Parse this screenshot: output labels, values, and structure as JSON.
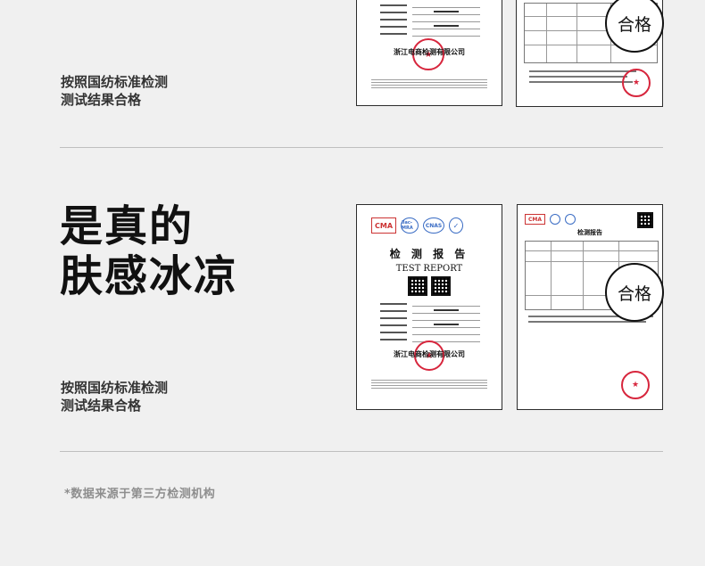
{
  "sections": [
    {
      "subtitle_lines": [
        "按照国纺标准检测",
        "测试结果合格"
      ],
      "certificate": {
        "org": "浙江电商检测有限公司"
      },
      "report": {
        "badge": "合格"
      }
    },
    {
      "headline_lines": [
        "是真的",
        "肤感冰凉"
      ],
      "subtitle_lines": [
        "按照国纺标准检测",
        "测试结果合格"
      ],
      "certificate": {
        "logos": [
          "CMA",
          "ilac-MRA",
          "CNAS",
          "✓"
        ],
        "title": "检 测 报 告",
        "title_en": "TEST REPORT",
        "org": "浙江电商检测有限公司"
      },
      "report": {
        "title": "检测报告",
        "badge": "合格"
      }
    }
  ],
  "footnote": "*数据来源于第三方检测机构",
  "colors": {
    "background": "#f0f0f0",
    "seal_red": "#d7263d",
    "divider": "#bfbfbf"
  }
}
